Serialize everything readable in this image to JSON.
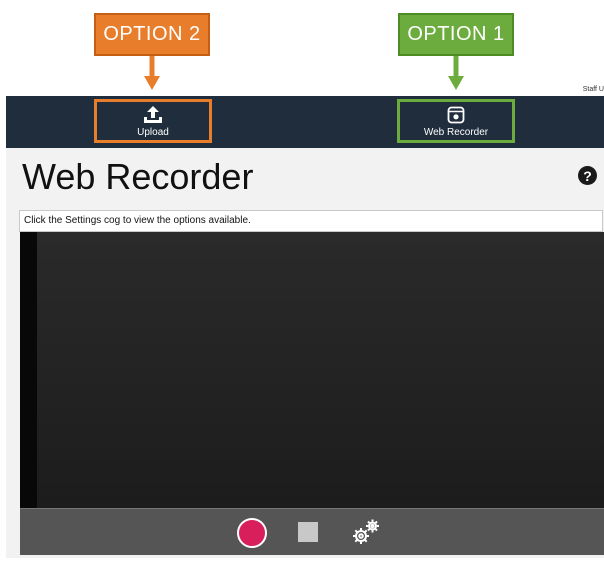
{
  "callouts": {
    "option2": "OPTION 2",
    "option1": "OPTION 1"
  },
  "header": {
    "user_text": "Staff U"
  },
  "nav": {
    "upload_label": "Upload",
    "recorder_label": "Web Recorder"
  },
  "main": {
    "title": "Web Recorder",
    "help_symbol": "?",
    "hint_text": "Click the Settings cog to view the options available."
  },
  "colors": {
    "navbar": "#1f2d3d",
    "option2_orange": "#e87d2c",
    "option1_green": "#6cac3e",
    "record_button": "#d81e5b"
  },
  "icons": {
    "upload": "upload-icon",
    "recorder": "recorder-icon",
    "help": "help-icon",
    "record": "record-icon",
    "stop": "stop-icon",
    "settings": "gears-icon"
  }
}
